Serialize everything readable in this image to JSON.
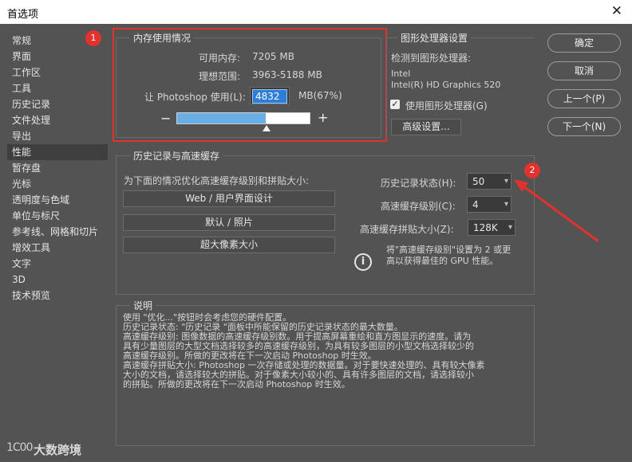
{
  "window": {
    "title": "首选项"
  },
  "sidebar": {
    "items": [
      {
        "label": "常规"
      },
      {
        "label": "界面"
      },
      {
        "label": "工作区"
      },
      {
        "label": "工具"
      },
      {
        "label": "历史记录"
      },
      {
        "label": "文件处理"
      },
      {
        "label": "导出"
      },
      {
        "label": "性能"
      },
      {
        "label": "暂存盘"
      },
      {
        "label": "光标"
      },
      {
        "label": "透明度与色域"
      },
      {
        "label": "单位与标尺"
      },
      {
        "label": "参考线、网格和切片"
      },
      {
        "label": "增效工具"
      },
      {
        "label": "文字"
      },
      {
        "label": "3D"
      },
      {
        "label": "技术预览"
      }
    ],
    "selected": "性能"
  },
  "annotations": {
    "badge1": "1",
    "badge2": "2",
    "accent_color": "#e2322d"
  },
  "memory": {
    "title": "内存使用情况",
    "available_label": "可用内存:",
    "available_value": "7205 MB",
    "ideal_label": "理想范围:",
    "ideal_value": "3963-5188 MB",
    "let_label": "让 Photoshop 使用(L):",
    "let_value": "4832",
    "let_unit": "MB(67%)",
    "slider_percent": 67,
    "minus": "−",
    "plus": "+"
  },
  "gpu": {
    "title": "图形处理器设置",
    "detected_label": "检测到图形处理器:",
    "vendor": "Intel",
    "model": "Intel(R) HD Graphics 520",
    "use_gpu_label": "使用图形处理器(G)",
    "use_gpu_checked": true,
    "advanced_button": "高级设置..."
  },
  "history_cache": {
    "title": "历史记录与高速缓存",
    "optimize_label": "为下面的情况优化高速缓存级别和拼贴大小:",
    "btn_web": "Web / 用户界面设计",
    "btn_default": "默认 / 照片",
    "btn_huge": "超大像素大小",
    "history_states_label": "历史记录状态(H):",
    "history_states_value": "50",
    "cache_levels_label": "高速缓存级别(C):",
    "cache_levels_value": "4",
    "tile_size_label": "高速缓存拼贴大小(Z):",
    "tile_size_value": "128K",
    "info_line1": "将\"高速缓存级别\"设置为 2 或更",
    "info_line2": "高以获得最佳的 GPU 性能。"
  },
  "description": {
    "title": "说明",
    "lines": [
      "使用 \"优化...\"按钮时会考虑您的硬件配置。",
      "历史记录状态: \"历史记录 \"面板中所能保留的历史记录状态的最大数量。",
      "高速缓存级别: 图像数据的高速缓存级别数。用于提高屏幕重绘和直方图显示的速度。请为",
      "具有少量图层的大型文档选择较多的高速缓存级别，为具有较多图层的小型文档选择较少的",
      "高速缓存级别。所做的更改将在下一次启动 Photoshop 时生效。",
      "高速缓存拼贴大小: Photoshop 一次存储或处理的数据量。对于要快速处理的、具有较大像素",
      "大小的文档，请选择较大的拼贴。对于像素大小较小的、具有许多图层的文档，请选择较小",
      "的拼贴。所做的更改将在下一次启动 Photoshop 时生效。"
    ]
  },
  "buttons": {
    "ok": "确定",
    "cancel": "取消",
    "prev": "上一个(P)",
    "next": "下一个(N)"
  },
  "watermark": {
    "text": "大数跨境",
    "mark": "1C00"
  }
}
